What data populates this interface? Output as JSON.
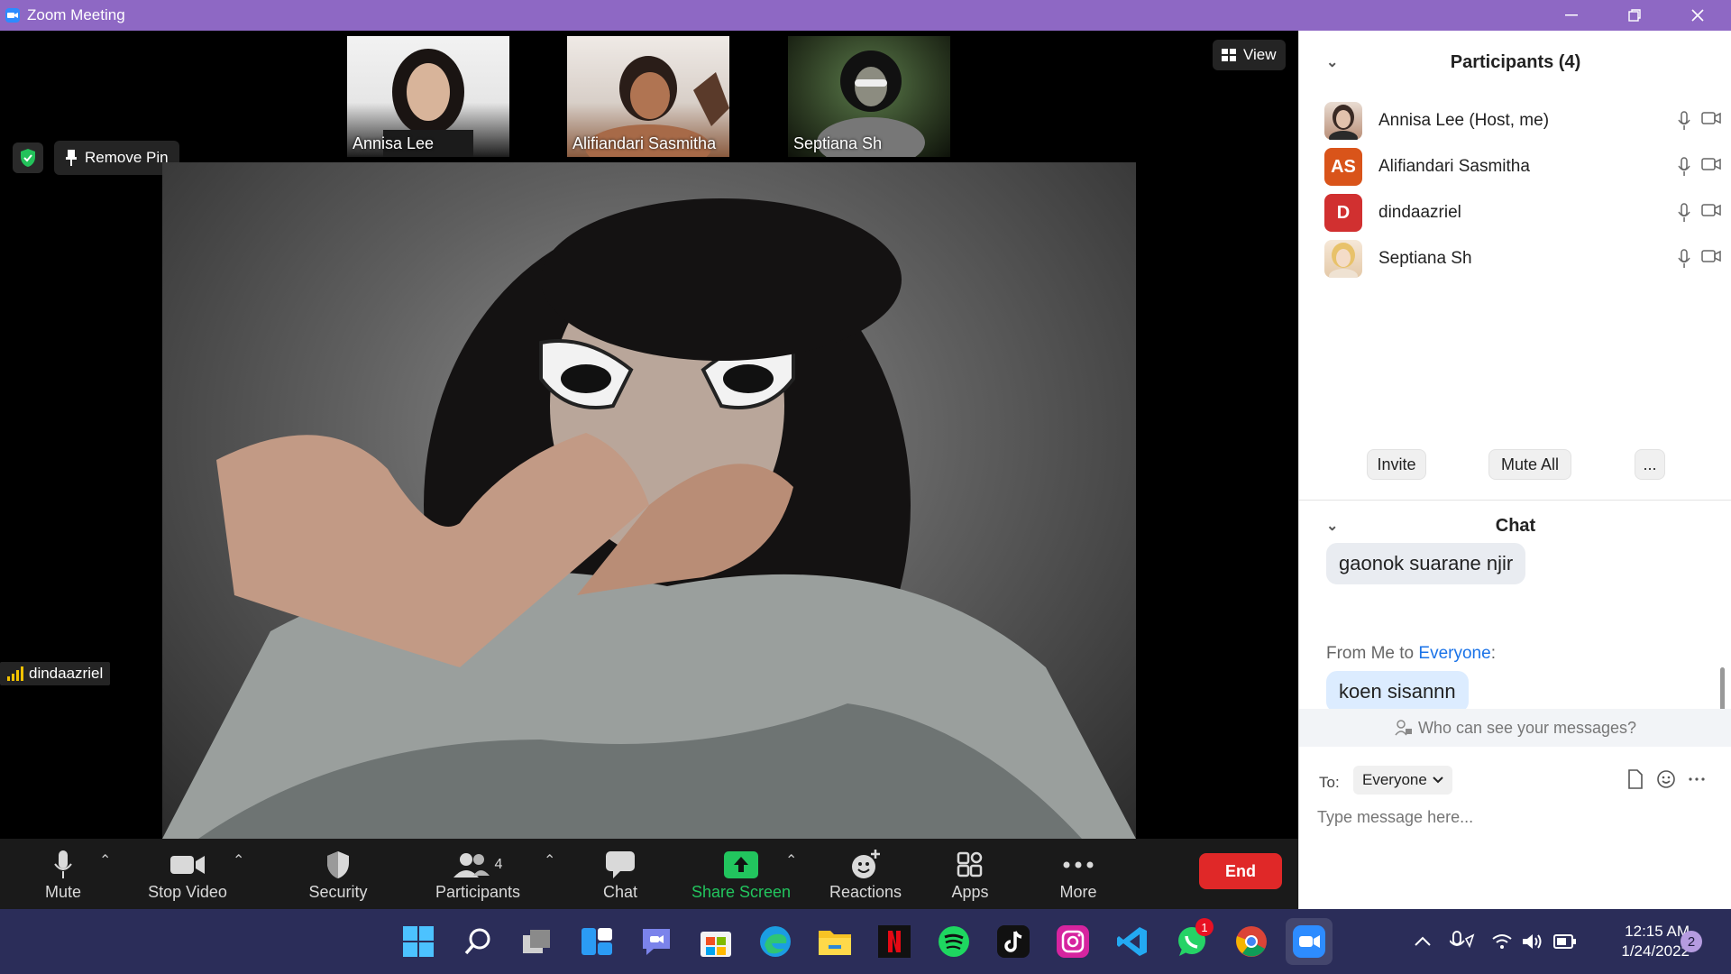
{
  "window": {
    "title": "Zoom Meeting"
  },
  "thumbnails": [
    {
      "name": "Annisa Lee"
    },
    {
      "name": "Alifiandari Sasmitha"
    },
    {
      "name": "Septiana Sh"
    }
  ],
  "view_button": {
    "label": "View"
  },
  "remove_pin": {
    "label": "Remove Pin"
  },
  "active_speaker": {
    "name": "dindaazriel"
  },
  "toolbar": {
    "mute": "Mute",
    "stop_video": "Stop Video",
    "security": "Security",
    "participants": "Participants",
    "participants_count": "4",
    "chat": "Chat",
    "share_screen": "Share Screen",
    "reactions": "Reactions",
    "apps": "Apps",
    "more": "More",
    "end": "End"
  },
  "participants_panel": {
    "title": "Participants (4)",
    "items": [
      {
        "name": "Annisa Lee (Host, me)",
        "avatar": "photo",
        "color": "#c9a58f"
      },
      {
        "name": "Alifiandari Sasmitha",
        "avatar": "AS",
        "color": "#d9541a"
      },
      {
        "name": "dindaazriel",
        "avatar": "D",
        "color": "#d13030"
      },
      {
        "name": "Septiana Sh",
        "avatar": "photo",
        "color": "#e9d3b5"
      }
    ],
    "invite": "Invite",
    "mute_all": "Mute All",
    "more": "..."
  },
  "chat_panel": {
    "title": "Chat",
    "messages": [
      {
        "text": "gaonok suarane njir"
      },
      {
        "text": "koen sisannn"
      }
    ],
    "from_prefix": "From Me to ",
    "from_target": "Everyone",
    "from_suffix": ":",
    "who_can_see": "Who can see your messages?",
    "to_label": "To:",
    "to_value": "Everyone",
    "placeholder": "Type message here..."
  },
  "taskbar": {
    "time": "12:15 AM",
    "date": "1/24/2022",
    "notification_count": "2",
    "whatsapp_badge": "1"
  },
  "colors": {
    "titlebar": "#8e68c4",
    "end_button": "#e02828",
    "share_screen": "#22c55e",
    "link": "#1a73e8"
  }
}
